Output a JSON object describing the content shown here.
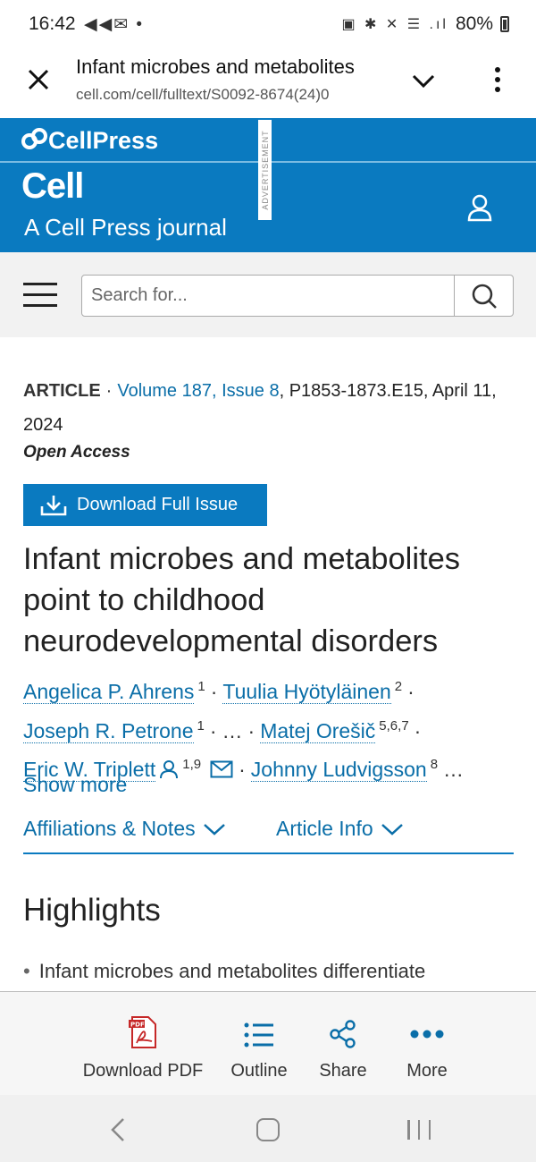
{
  "status_bar": {
    "time": "16:42",
    "left_icons": "◀◀✉ •",
    "right_icons": "▣ ✱ ✕ ☰ .ıl",
    "battery": "80%"
  },
  "browser": {
    "page_title": "Infant microbes and metabolites",
    "url": "cell.com/cell/fulltext/S0092-8674(24)0"
  },
  "header": {
    "cellpress_logo": "CellPress",
    "journal_logo": "Cell",
    "journal_subtitle": "A Cell Press journal",
    "advertisement": "ADVERTISEMENT"
  },
  "search": {
    "placeholder": "Search for..."
  },
  "article": {
    "type": "ARTICLE",
    "volume_link": "Volume 187, Issue 8",
    "pages_date": ", P1853-1873.E15, April 11, 2024",
    "open_access": "Open Access",
    "download_issue": "Download Full Issue",
    "title": "Infant microbes and metabolites point to childhood neurodevelopmental disorders",
    "authors": [
      {
        "name": "Angelica P. Ahrens",
        "aff": "1"
      },
      {
        "name": "Tuulia Hyötyläinen",
        "aff": "2"
      },
      {
        "name": "Joseph R. Petrone",
        "aff": "1"
      },
      {
        "name": "Matej Orešič",
        "aff": "5,6,7"
      },
      {
        "name": "Eric W. Triplett",
        "aff": "1,9"
      },
      {
        "name": "Johnny Ludvigsson",
        "aff": "8"
      }
    ],
    "ellipsis": "…",
    "show_more": "Show more",
    "tab_affiliations": "Affiliations & Notes",
    "tab_article_info": "Article Info",
    "highlights_heading": "Highlights",
    "highlight_1": "Infant microbes and metabolites differentiate"
  },
  "actions": {
    "download_pdf": "Download PDF",
    "outline": "Outline",
    "share": "Share",
    "more": "More"
  },
  "colors": {
    "brand_blue": "#0a7ac0",
    "link_blue": "#0a6ea8"
  }
}
